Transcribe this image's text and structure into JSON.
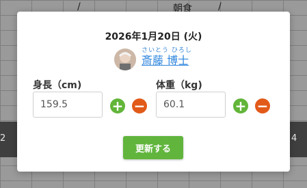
{
  "background": {
    "header_meal": "朝食",
    "left_edge_number": "2",
    "right_edge_number": "4",
    "slash": "/"
  },
  "modal": {
    "date": "2026年1月20日 (火)",
    "user": {
      "furigana": "さいとう ひろし",
      "name": "斎藤 博士"
    },
    "height": {
      "label": "身長（cm)",
      "value": "159.5"
    },
    "weight": {
      "label": "体重（kg)",
      "value": "60.1"
    },
    "update_label": "更新する",
    "plus_symbol": "+",
    "minus_symbol": "−"
  },
  "colors": {
    "plus": "#62b539",
    "minus": "#e25a1a",
    "link": "#2e86de",
    "button": "#61b53d"
  }
}
